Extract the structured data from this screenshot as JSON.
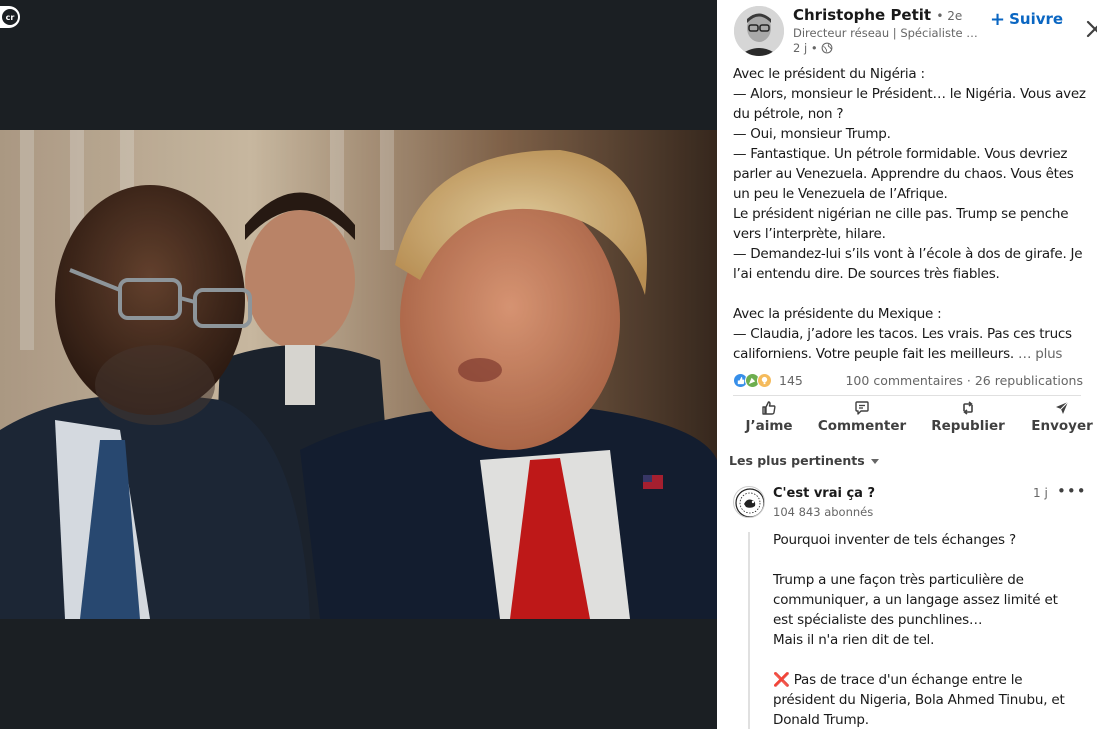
{
  "viewer": {
    "badge": "cr"
  },
  "author": {
    "name": "Christophe Petit",
    "degree": "• 2e",
    "headline": "Directeur réseau | Spécialiste fra…",
    "time": "2 j •",
    "visibility_icon": "globe-icon"
  },
  "follow": {
    "plus": "+",
    "label": "Suivre"
  },
  "close_icon": "close-icon",
  "post": {
    "text": "Avec le président du Nigéria :\n— Alors, monsieur le Président… le Nigéria. Vous avez du pétrole, non ?\n— Oui, monsieur Trump.\n— Fantastique. Un pétrole formidable. Vous devriez parler au Venezuela. Apprendre du chaos. Vous êtes un peu le Venezuela de l’Afrique.\nLe président nigérian ne cille pas. Trump se penche vers l’interprète, hilare.\n— Demandez-lui s’ils vont à l’école à dos de girafe. Je l’ai entendu dire. De sources très fiables.\n\nAvec la présidente du Mexique :\n— Claudia, j’adore les tacos. Les vrais. Pas ces trucs californiens. Votre peuple fait les meilleurs. ",
    "more": "… plus"
  },
  "social": {
    "reaction_count": "145",
    "comments": "100 commentaires",
    "separator": " · ",
    "reposts": "26 republications"
  },
  "actions": [
    {
      "label": "J’aime",
      "icon": "like-icon"
    },
    {
      "label": "Commenter",
      "icon": "comment-icon"
    },
    {
      "label": "Republier",
      "icon": "repost-icon"
    },
    {
      "label": "Envoyer",
      "icon": "send-icon"
    }
  ],
  "sort": {
    "label": "Les plus pertinents",
    "icon": "caret-down-icon"
  },
  "comment": {
    "name": "C'est vrai ça ?",
    "followers": "104 843 abonnés",
    "time": "1 j",
    "menu": "•••",
    "paragraph1": "Pourquoi inventer de tels échanges ?",
    "paragraph2": "Trump a une façon très particulière de communiquer, a un langage assez limité et est spécialiste des punchlines…\nMais il n'a rien dit de tel.",
    "mark": "❌",
    "paragraph3": " Pas de trace d'un échange entre le président du Nigeria, Bola Ahmed Tinubu, et Donald Trump."
  },
  "colors": {
    "accent": "#0a66c2",
    "viewer_bg": "#1b1f23",
    "text": "#191919",
    "muted": "#666666"
  }
}
